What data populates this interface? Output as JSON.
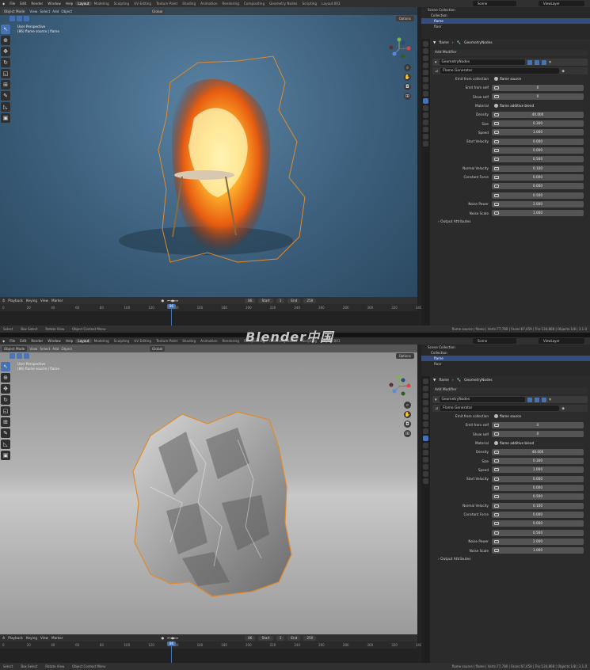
{
  "menubar": {
    "items": [
      "File",
      "Edit",
      "Render",
      "Window",
      "Help"
    ],
    "workspaces": [
      "Layout",
      "Modeling",
      "Sculpting",
      "UV Editing",
      "Texture Paint",
      "Shading",
      "Animation",
      "Rendering",
      "Compositing",
      "Geometry Nodes",
      "Scripting",
      "Layout.001"
    ],
    "active_workspace": "Layout",
    "scene": "Scene",
    "view_layer": "ViewLayer"
  },
  "viewport_header": {
    "mode": "Object Mode",
    "menus": [
      "View",
      "Select",
      "Add",
      "Object"
    ],
    "transform": "Global",
    "options": "Options"
  },
  "viewport": {
    "line1": "User Perspective",
    "line2": "(86) flame source | flame"
  },
  "timeline": {
    "menus": [
      "Playback",
      "Keying",
      "View",
      "Marker"
    ],
    "current_frame": "86",
    "start_label": "Start",
    "start": "1",
    "end_label": "End",
    "end": "250",
    "ruler": [
      "0",
      "20",
      "40",
      "60",
      "80",
      "100",
      "120",
      "140",
      "160",
      "180",
      "200",
      "220",
      "240",
      "260",
      "280",
      "300",
      "320",
      "340"
    ],
    "ruler_prefix": [
      "300",
      "320",
      "340",
      "360",
      "380"
    ]
  },
  "status": {
    "select": "Select",
    "box": "Box Select",
    "rotate": "Rotate View",
    "context": "Object Context Menu",
    "stats": "flame source | flame | Verts:77,780 | Faces:67,459 | Tris:134,868 | Objects:1/8 | 3.1.0"
  },
  "outliner": {
    "rows": [
      "Scene Collection",
      "Collection",
      "flame",
      "floor"
    ],
    "selected_index": 2
  },
  "properties": {
    "breadcrumb_obj": "flame",
    "breadcrumb_mod": "GeometryNodes",
    "add_modifier": "Add Modifier",
    "modifier_name": "GeometryNodes",
    "node_group": "Flame Generator",
    "rows": [
      {
        "label": "Emit from collection",
        "value": "flame source",
        "kind": "dark"
      },
      {
        "label": "Emit from self",
        "value": "0",
        "kind": "num"
      },
      {
        "label": "Show self",
        "value": "0",
        "kind": "num"
      },
      {
        "label": "Material",
        "value": "flame additive blend",
        "kind": "dark"
      },
      {
        "label": "Density",
        "value": "40.000",
        "kind": "num"
      },
      {
        "label": "Size",
        "value": "0.300",
        "kind": "num"
      },
      {
        "label": "Speed",
        "value": "1.000",
        "kind": "num"
      },
      {
        "label": "Start Velocity",
        "value": "0.000",
        "kind": "num"
      },
      {
        "label": "",
        "value": "0.000",
        "kind": "num"
      },
      {
        "label": "",
        "value": "0.500",
        "kind": "num"
      },
      {
        "label": "Normal Velocity",
        "value": "0.100",
        "kind": "num"
      },
      {
        "label": "Constant Force",
        "value": "0.000",
        "kind": "num"
      },
      {
        "label": "",
        "value": "0.000",
        "kind": "num"
      },
      {
        "label": "",
        "value": "0.500",
        "kind": "num"
      },
      {
        "label": "Noise Power",
        "value": "2.000",
        "kind": "num"
      },
      {
        "label": "Noise Scale",
        "value": "1.000",
        "kind": "num"
      }
    ],
    "output_attributes": "Output Attributes"
  },
  "watermark": "Blender中国",
  "colors": {
    "accent": "#4772b3",
    "viewport_top_bg": "#3c5f7c",
    "viewport_bottom_bg": "#a9a9a9",
    "selection_outline": "#e08a2c"
  }
}
